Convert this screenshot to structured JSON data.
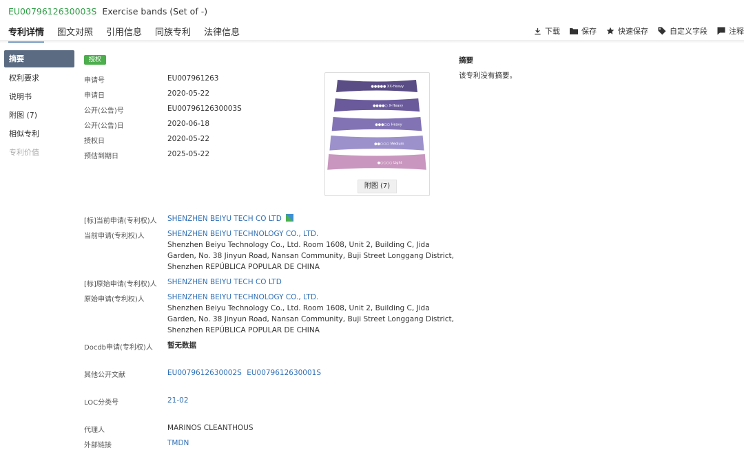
{
  "header": {
    "patent_number": "EU0079612630003S",
    "title": "Exercise bands (Set of -)"
  },
  "tabs": [
    {
      "label": "专利详情",
      "active": true
    },
    {
      "label": "图文对照"
    },
    {
      "label": "引用信息"
    },
    {
      "label": "同族专利"
    },
    {
      "label": "法律信息"
    }
  ],
  "toolbar": {
    "download": "下载",
    "save": "保存",
    "quick_save": "快速保存",
    "custom_field": "自定义字段",
    "annotate": "注释"
  },
  "sidebar": {
    "items": [
      {
        "label": "摘要",
        "active": true
      },
      {
        "label": "权利要求"
      },
      {
        "label": "说明书"
      },
      {
        "label": "附图 (7)"
      },
      {
        "label": "相似专利"
      },
      {
        "label": "专利价值",
        "disabled": true
      }
    ]
  },
  "status_badge": "授权",
  "fields": {
    "app_no": {
      "label": "申请号",
      "value": "EU007961263"
    },
    "app_date": {
      "label": "申请日",
      "value": "2020-05-22"
    },
    "pub_no": {
      "label": "公开(公告)号",
      "value": "EU0079612630003S"
    },
    "pub_date": {
      "label": "公开(公告)日",
      "value": "2020-06-18"
    },
    "grant_date": {
      "label": "授权日",
      "value": "2020-05-22"
    },
    "expiry_date": {
      "label": "预估到期日",
      "value": "2025-05-22"
    },
    "std_current_applicant": {
      "label": "[标]当前申请(专利权)人",
      "value": "SHENZHEN BEIYU TECH CO LTD"
    },
    "current_applicant": {
      "label": "当前申请(专利权)人",
      "name": "SHENZHEN BEIYU TECHNOLOGY CO., LTD.",
      "address_lines": [
        "Shenzhen Beiyu Technology Co., Ltd. Room 1608, Unit 2, Building C, Jida",
        "Garden, No. 38 Jinyun Road, Nansan Community, Buji Street Longgang District,",
        "Shenzhen REPÚBLICA POPULAR DE CHINA"
      ]
    },
    "std_original_applicant": {
      "label": "[标]原始申请(专利权)人",
      "value": "SHENZHEN BEIYU TECH CO LTD"
    },
    "original_applicant": {
      "label": "原始申请(专利权)人",
      "name": "SHENZHEN BEIYU TECHNOLOGY CO., LTD.",
      "address_lines": [
        "Shenzhen Beiyu Technology Co., Ltd. Room 1608, Unit 2, Building C, Jida",
        "Garden, No. 38 Jinyun Road, Nansan Community, Buji Street Longgang District,",
        "Shenzhen REPÚBLICA POPULAR DE CHINA"
      ]
    },
    "docdb_applicant": {
      "label": "Docdb申请(专利权)人",
      "value": "暂无数据"
    },
    "other_docs": {
      "label": "其他公开文献",
      "values": [
        "EU0079612630002S",
        "EU0079612630001S"
      ]
    },
    "loc_class": {
      "label": "LOC分类号",
      "value": "21-02"
    },
    "agent": {
      "label": "代理人",
      "value": "MARINOS CLEANTHOUS"
    },
    "external_link": {
      "label": "外部链接",
      "value": "TMDN"
    }
  },
  "figure": {
    "button_label": "附图 (7)",
    "bands": [
      {
        "text": "●●●●● XX-Heavy",
        "color": "#5a4d86"
      },
      {
        "text": "●●●●○ X-Heavy",
        "color": "#6a5a9c"
      },
      {
        "text": "●●●○○ Heavy",
        "color": "#8274b4"
      },
      {
        "text": "●●○○○ Medium",
        "color": "#9d91cc"
      },
      {
        "text": "●○○○○ Light",
        "color": "#c896be"
      }
    ]
  },
  "abstract": {
    "title": "摘要",
    "text": "该专利没有摘要。"
  }
}
